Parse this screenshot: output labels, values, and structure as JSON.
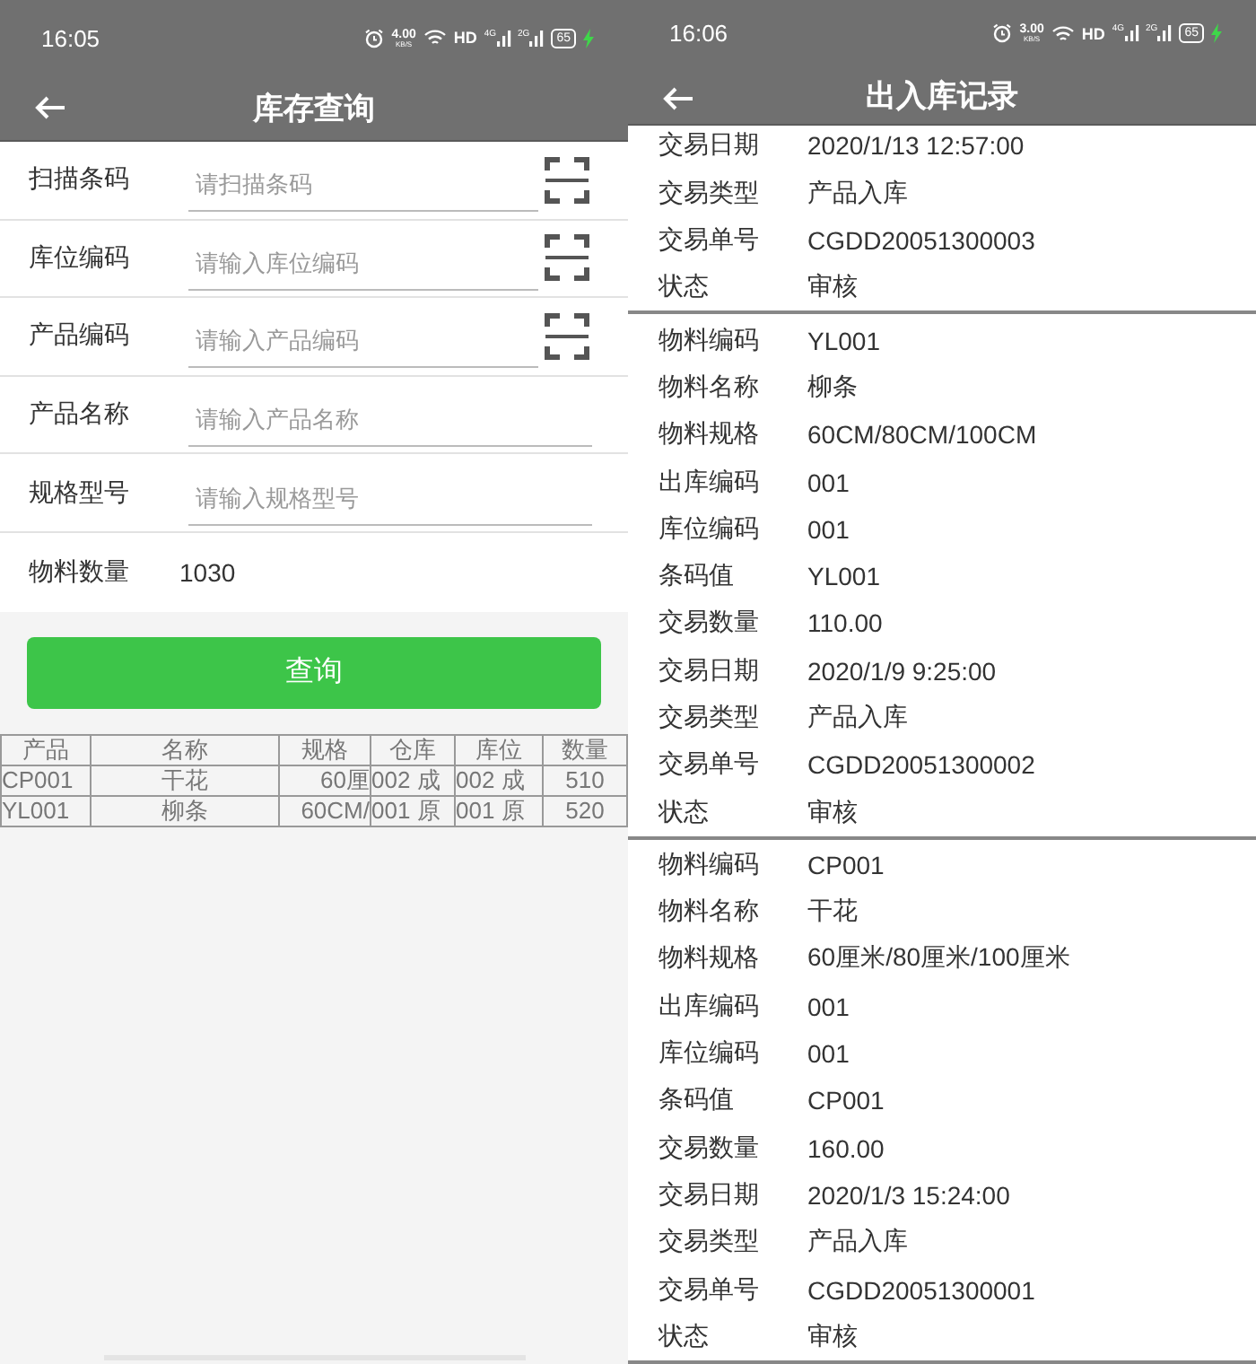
{
  "left_screen": {
    "status_bar": {
      "time": "16:05",
      "speed": "4.00",
      "speed_unit": "KB/S",
      "hd": "HD",
      "net_1": "4G",
      "net_2": "2G",
      "battery": "65",
      "charging": true
    },
    "title": "库存查询",
    "fields": [
      {
        "label": "扫描条码",
        "placeholder": "请扫描条码",
        "scan": true
      },
      {
        "label": "库位编码",
        "placeholder": "请输入库位编码",
        "scan": true
      },
      {
        "label": "产品编码",
        "placeholder": "请输入产品编码",
        "scan": true
      },
      {
        "label": "产品名称",
        "placeholder": "请输入产品名称",
        "scan": false
      },
      {
        "label": "规格型号",
        "placeholder": "请输入规格型号",
        "scan": false
      }
    ],
    "quantity": {
      "label": "物料数量",
      "value": "1030"
    },
    "query_button": "查询",
    "table": {
      "columns": [
        "产品",
        "名称",
        "规格",
        "仓库",
        "库位",
        "数量"
      ],
      "rows": [
        [
          "CP001",
          "干花",
          "60厘",
          "002 成",
          "002 成",
          "510"
        ],
        [
          "YL001",
          "柳条",
          "60CM/",
          "001 原",
          "001 原",
          "520"
        ]
      ]
    }
  },
  "right_screen": {
    "status_bar": {
      "time": "16:06",
      "speed": "3.00",
      "speed_unit": "KB/S",
      "hd": "HD",
      "net_1": "4G",
      "net_2": "2G",
      "battery": "65",
      "charging": true
    },
    "title": "出入库记录",
    "records": [
      [
        {
          "label": "交易日期",
          "value": "2020/1/13 12:57:00"
        },
        {
          "label": "交易类型",
          "value": "产品入库"
        },
        {
          "label": "交易单号",
          "value": "CGDD20051300003"
        },
        {
          "label": "状态",
          "value": "审核"
        }
      ],
      [
        {
          "label": "物料编码",
          "value": "YL001"
        },
        {
          "label": "物料名称",
          "value": "柳条"
        },
        {
          "label": "物料规格",
          "value": "60CM/80CM/100CM"
        },
        {
          "label": "出库编码",
          "value": "001"
        },
        {
          "label": "库位编码",
          "value": "001"
        },
        {
          "label": "条码值",
          "value": "YL001"
        },
        {
          "label": "交易数量",
          "value": "110.00"
        },
        {
          "label": "交易日期",
          "value": "2020/1/9 9:25:00"
        },
        {
          "label": "交易类型",
          "value": "产品入库"
        },
        {
          "label": "交易单号",
          "value": "CGDD20051300002"
        },
        {
          "label": "状态",
          "value": "审核"
        }
      ],
      [
        {
          "label": "物料编码",
          "value": "CP001"
        },
        {
          "label": "物料名称",
          "value": "干花"
        },
        {
          "label": "物料规格",
          "value": "60厘米/80厘米/100厘米"
        },
        {
          "label": "出库编码",
          "value": "001"
        },
        {
          "label": "库位编码",
          "value": "001"
        },
        {
          "label": "条码值",
          "value": "CP001"
        },
        {
          "label": "交易数量",
          "value": "160.00"
        },
        {
          "label": "交易日期",
          "value": "2020/1/3 15:24:00"
        },
        {
          "label": "交易类型",
          "value": "产品入库"
        },
        {
          "label": "交易单号",
          "value": "CGDD20051300001"
        },
        {
          "label": "状态",
          "value": "审核"
        }
      ]
    ]
  }
}
